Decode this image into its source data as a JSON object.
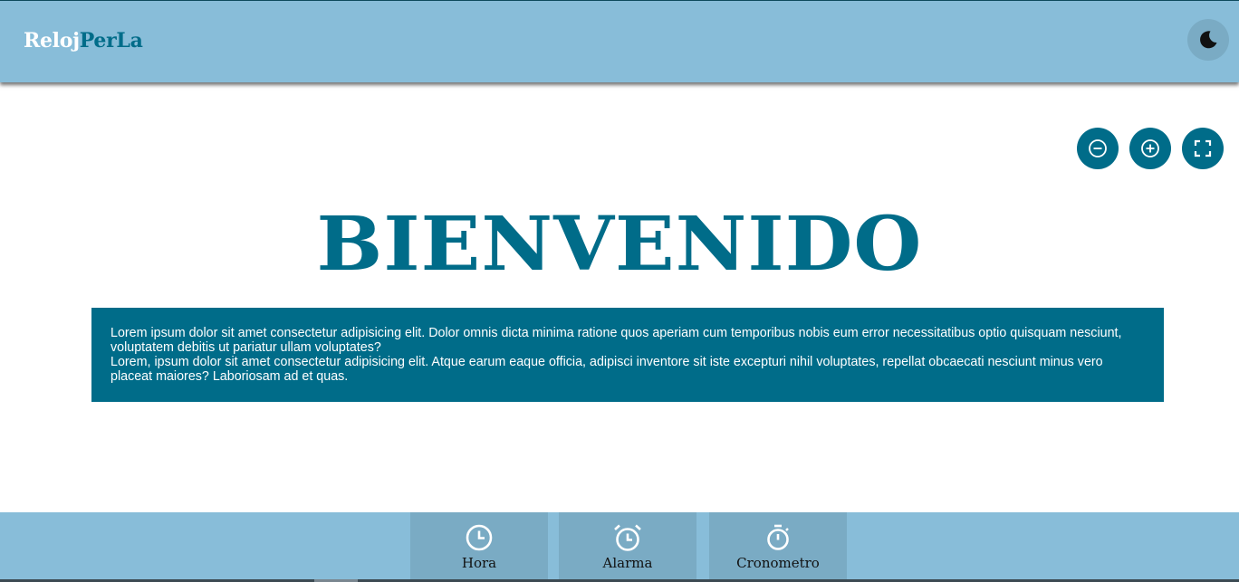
{
  "header": {
    "logo_part1": "Reloj",
    "logo_part2": "PerLa",
    "theme_toggle_icon": "moon-icon"
  },
  "tools": [
    {
      "name": "zoom-out",
      "icon": "minus-circle-icon"
    },
    {
      "name": "zoom-in",
      "icon": "plus-circle-icon"
    },
    {
      "name": "fullscreen",
      "icon": "fullscreen-icon"
    }
  ],
  "main": {
    "title": "BIENVENIDO",
    "paragraph1": "Lorem ipsum dolor sit amet consectetur adipisicing elit. Dolor omnis dicta minima ratione quos aperiam cum temporibus nobis eum error necessitatibus optio quisquam nesciunt, voluptatem debitis ut pariatur ullam voluptates?",
    "paragraph2": "Lorem, ipsum dolor sit amet consectetur adipisicing elit. Atque earum eaque officia, adipisci inventore sit iste excepturi nihil voluptates, repellat obcaecati nesciunt minus vero placeat maiores? Laboriosam ad et quas."
  },
  "nav": {
    "items": [
      {
        "label": "Hora",
        "icon": "clock-icon"
      },
      {
        "label": "Alarma",
        "icon": "alarm-clock-icon"
      },
      {
        "label": "Cronometro",
        "icon": "stopwatch-icon"
      }
    ]
  },
  "colors": {
    "header_bg": "#88bdd9",
    "accent": "#006c89",
    "nav_button_bg": "#7aabc4"
  }
}
